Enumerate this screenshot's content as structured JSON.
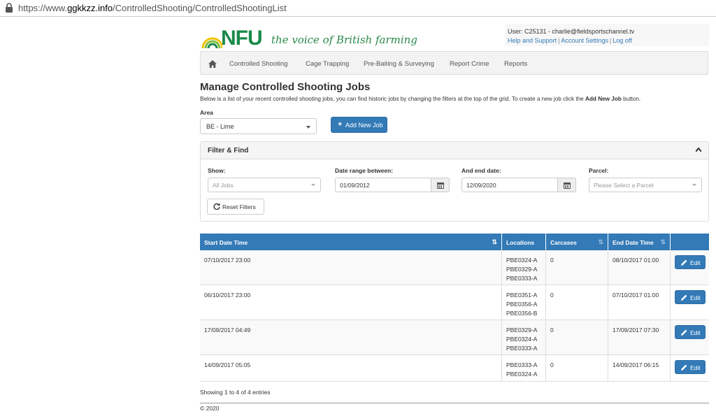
{
  "browser": {
    "url_prefix": "https://www.",
    "url_domain": "ggkkzz.info",
    "url_path": "/ControlledShooting/ControlledShootingList"
  },
  "header": {
    "logo_text": "NFU",
    "tagline": "the voice of British farming",
    "user_line": "User: C25131 - charlie@fieldsportschannel.tv",
    "links": [
      "Help and Support",
      "Account Settings",
      "Log off"
    ]
  },
  "nav": {
    "items": [
      "Controlled Shooting",
      "Cage Trapping",
      "Pre-Baiting & Surveying",
      "Report Crime",
      "Reports"
    ]
  },
  "page": {
    "title": "Manage Controlled Shooting Jobs",
    "description_pre": "Below is a list of your recent controlled shooting jobs, you can find historic jobs by changing the filters at the top of the grid. To create a new job click the ",
    "description_bold": "Add New Job",
    "description_post": " button.",
    "area_label": "Area",
    "area_value": "BE - Lime",
    "add_button": "Add New Job"
  },
  "filter": {
    "title": "Filter & Find",
    "show_label": "Show:",
    "show_value": "All Jobs",
    "date_from_label": "Date range between:",
    "date_from": "01/09/2012",
    "date_to_label": "And end date:",
    "date_to": "12/09/2020",
    "parcel_label": "Parcel:",
    "parcel_placeholder": "Please Select a Parcel",
    "reset_button": "Reset Filters"
  },
  "table": {
    "columns": [
      "Start Date Time",
      "Locations",
      "Carcases",
      "End Date Time",
      ""
    ],
    "rows": [
      {
        "start": "07/10/2017 23:00",
        "locations": [
          "PBE0324-A",
          "PBE0329-A",
          "PBE0333-A"
        ],
        "carcases": "0",
        "end": "08/10/2017 01:00",
        "action": "Edit"
      },
      {
        "start": "06/10/2017 23:00",
        "locations": [
          "PBE0351-A",
          "PBE0356-A",
          "PBE0356-B"
        ],
        "carcases": "0",
        "end": "07/10/2017 01:00",
        "action": "Edit"
      },
      {
        "start": "17/09/2017 04:49",
        "locations": [
          "PBE0329-A",
          "PBE0324-A",
          "PBE0333-A"
        ],
        "carcases": "0",
        "end": "17/09/2017 07:30",
        "action": "Edit"
      },
      {
        "start": "14/09/2017 05:05",
        "locations": [
          "PBE0333-A",
          "PBE0324-A"
        ],
        "carcases": "0",
        "end": "14/09/2017 06:15",
        "action": "Edit"
      }
    ],
    "entries_text": "Showing 1 to 4 of 4 entries"
  },
  "footer": {
    "copyright": "© 2020"
  },
  "colors": {
    "primary": "#337ab7",
    "brand_green": "#1a8a4a"
  }
}
